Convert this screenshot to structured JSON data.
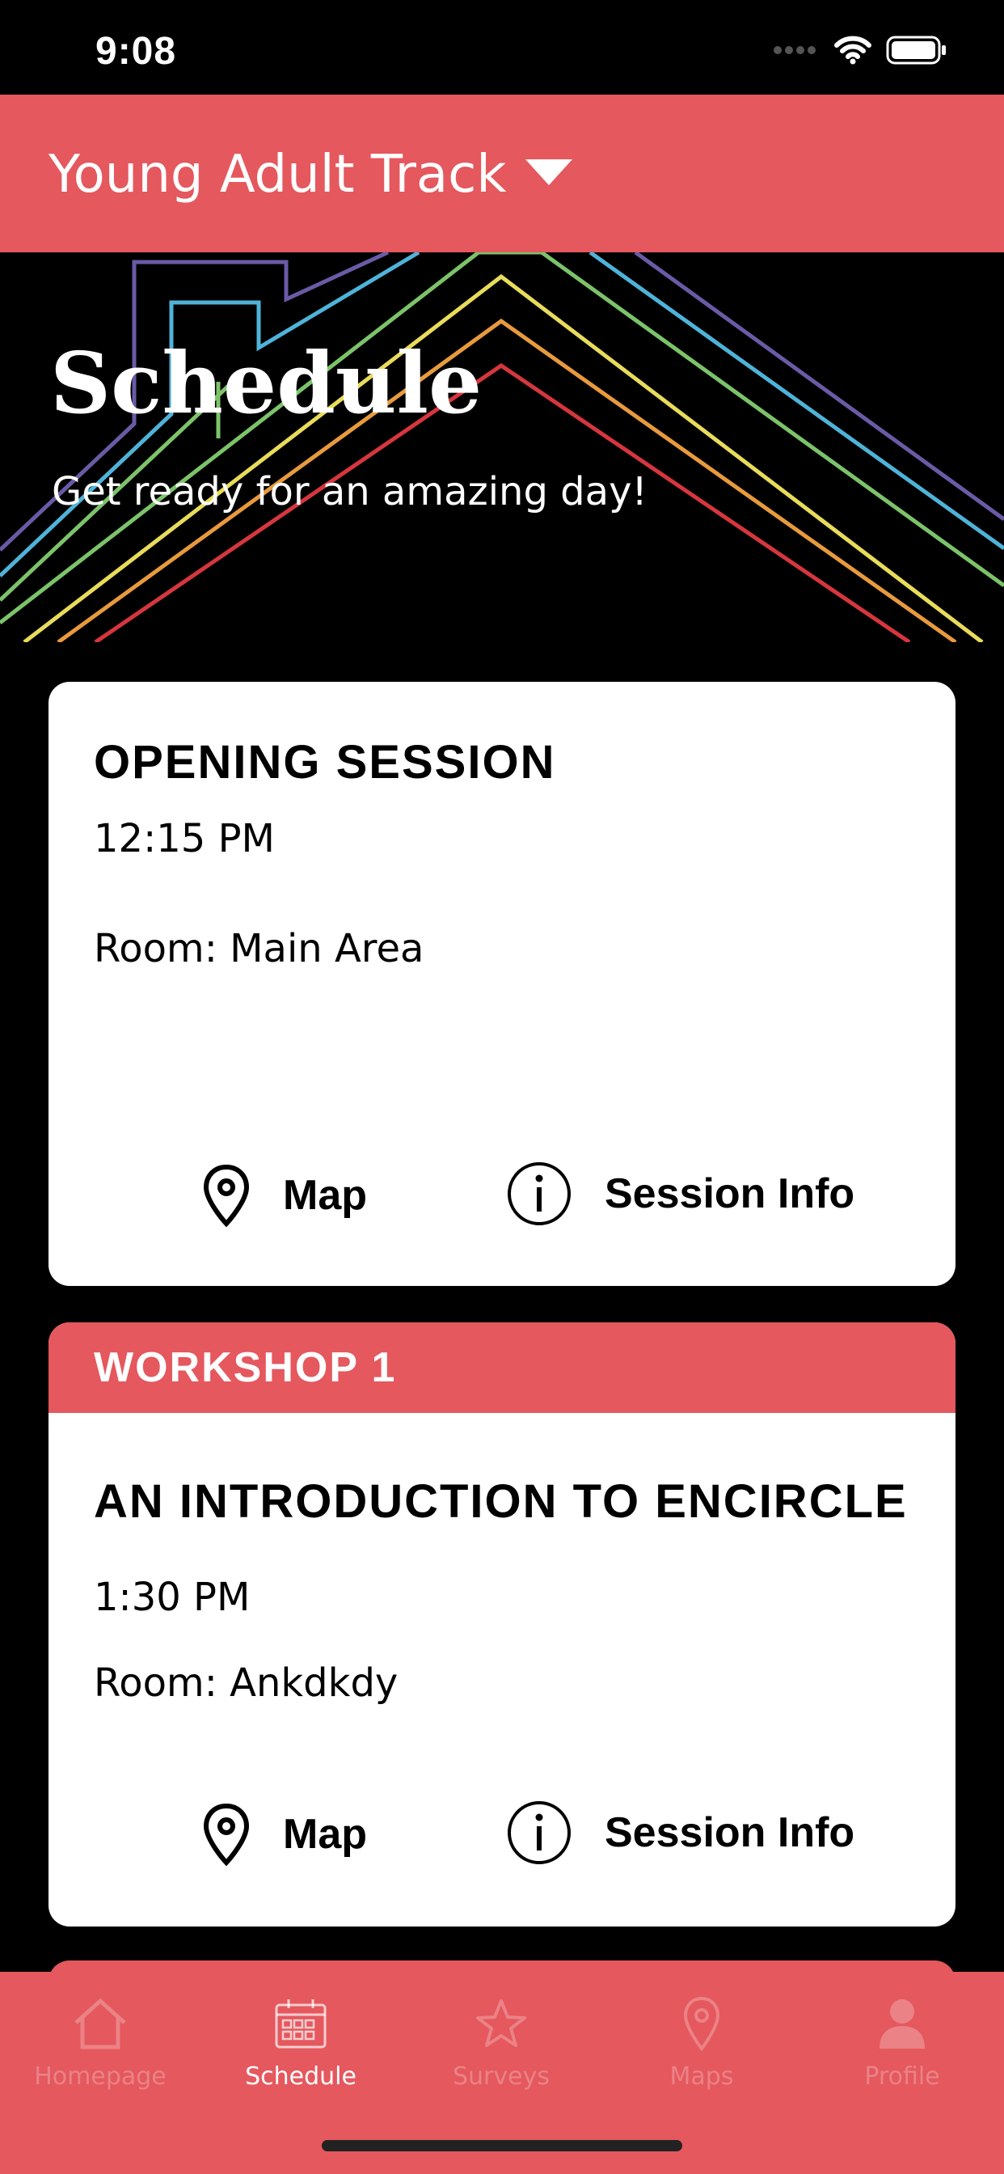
{
  "status_bar": {
    "time": "9:08"
  },
  "header": {
    "track_title": "Young Adult Track"
  },
  "hero": {
    "title": "Schedule",
    "subtitle": "Get ready for an amazing day!"
  },
  "sessions": [
    {
      "banner": "",
      "title": "OPENING SESSION",
      "time": "12:15 PM",
      "room": "Room: Main Area",
      "map_label": "Map",
      "info_label": "Session Info"
    },
    {
      "banner": "WORKSHOP 1",
      "title": "AN INTRODUCTION TO ENCIRCLE",
      "time": "1:30 PM",
      "room": "Room: Ankdkdy",
      "map_label": "Map",
      "info_label": "Session Info"
    }
  ],
  "tabs": [
    {
      "label": "Homepage",
      "icon": "home-icon",
      "active": false
    },
    {
      "label": "Schedule",
      "icon": "calendar-icon",
      "active": true
    },
    {
      "label": "Surveys",
      "icon": "star-icon",
      "active": false
    },
    {
      "label": "Maps",
      "icon": "map-pin-icon",
      "active": false
    },
    {
      "label": "Profile",
      "icon": "person-icon",
      "active": false
    }
  ],
  "colors": {
    "accent": "#e4585e",
    "background": "#000000",
    "card": "#ffffff"
  }
}
